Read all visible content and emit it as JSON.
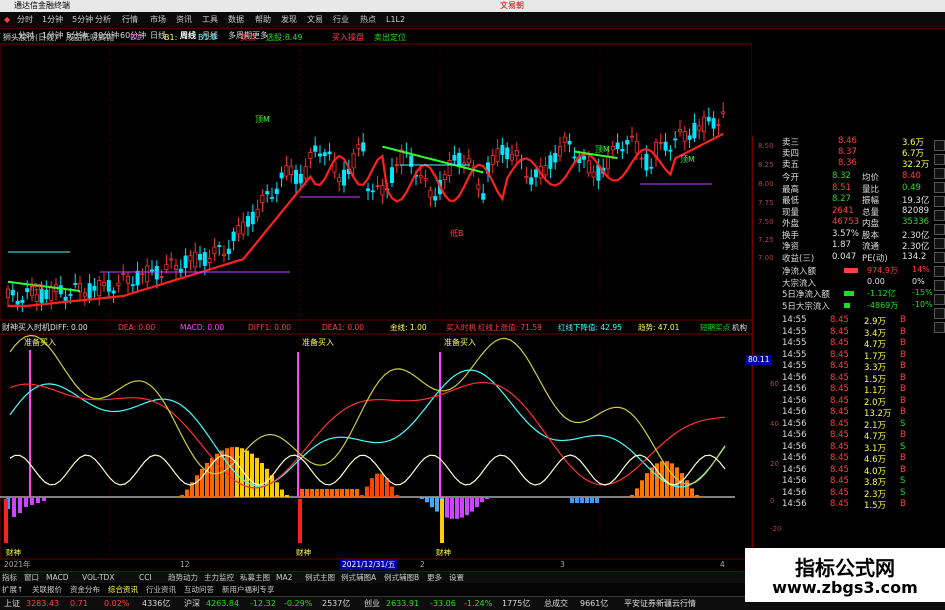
{
  "window": {
    "title": "通达信金融终端",
    "brand": "文易朝"
  },
  "menu": [
    "分时",
    "1分钟",
    "5分钟",
    "分析",
    "行情",
    "市场",
    "资讯",
    "工具",
    "数据",
    "帮助",
    "发现",
    "文易",
    "行业",
    "热点",
    "L1L2"
  ],
  "toolbar": {
    "periods": [
      "分时",
      "1分钟",
      "5分钟",
      "30分钟",
      "60分钟",
      "日线",
      "周线",
      "月线",
      "多周期",
      "更多"
    ],
    "active": "日线"
  },
  "main_chart": {
    "stock": "狮头股份(日线)",
    "indicator": "成品低吸高抛",
    "legend": [
      {
        "label": "B1:",
        "color": "#ff44ff"
      },
      {
        "label": "B1:",
        "color": "#ffff44"
      },
      {
        "label": "B1:8",
        "color": "#44ffff"
      },
      {
        "label": "卖点",
        "color": "#ff4040"
      },
      {
        "label": "选股:8.49",
        "color": "#22dd22"
      },
      {
        "label": "买入操盘",
        "color": "#ff4040"
      },
      {
        "label": "卖出定位",
        "color": "#22dd22"
      }
    ],
    "markers": [
      "顶M",
      "顶M",
      "顶M",
      "低B",
      "低B"
    ],
    "price_axis": [
      "8.50",
      "8.25",
      "8.00",
      "7.75",
      "7.50",
      "7.25",
      "7.00"
    ]
  },
  "sub_chart": {
    "name": "财神买入时机",
    "params": [
      {
        "label": "DIFF: 0.00",
        "color": "#e0e0e0"
      },
      {
        "label": "DEA: 0.00",
        "color": "#ff4040"
      },
      {
        "label": "MACD: 0.00",
        "color": "#ff44ff"
      },
      {
        "label": "DIFF1: 0.00",
        "color": "#ff4040"
      },
      {
        "label": "DEA1: 0.00",
        "color": "#ff4040"
      },
      {
        "label": "金线: 1.00",
        "color": "#ffff44"
      },
      {
        "label": "买入时机",
        "color": "#ff4040"
      },
      {
        "label": "红线上涨值: 71.59",
        "color": "#ff4040"
      },
      {
        "label": "红线下降值: 42.95",
        "color": "#44ffff"
      },
      {
        "label": "趋势: 47.01",
        "color": "#ffff44"
      },
      {
        "label": "短期买点",
        "color": "#22dd22"
      },
      {
        "label": "机构",
        "color": "#e0e0e0"
      }
    ],
    "buy_labels": [
      "准备买入",
      "准备买入",
      "准备买入"
    ],
    "y_axis": [
      "80.11",
      "60",
      "40",
      "20",
      "0",
      "-20"
    ],
    "bottom_labels": [
      "财神",
      "财神",
      "财神"
    ]
  },
  "date_axis": [
    "2021年",
    "12",
    "2021/12/31/五",
    "2",
    "3",
    "4"
  ],
  "order_book": {
    "asks": [
      {
        "label": "卖三",
        "price": "8.46",
        "vol": "3.6万"
      },
      {
        "label": "卖四",
        "price": "8.37",
        "vol": "6.7万"
      },
      {
        "label": "卖五",
        "price": "8.36",
        "vol": "32.2万"
      }
    ]
  },
  "quote_stats": [
    {
      "l1": "今开",
      "v1": "8.32",
      "c1": "grn",
      "l2": "均价",
      "v2": "8.40",
      "c2": "red"
    },
    {
      "l1": "最高",
      "v1": "8.51",
      "c1": "red",
      "l2": "量比",
      "v2": "0.49",
      "c2": "grn"
    },
    {
      "l1": "最低",
      "v1": "8.27",
      "c1": "grn",
      "l2": "振幅",
      "v2": "19.3亿",
      "c2": "wht"
    },
    {
      "l1": "现量",
      "v1": "2641",
      "c1": "red",
      "l2": "总量",
      "v2": "82089",
      "c2": "wht"
    },
    {
      "l1": "外盘",
      "v1": "46753",
      "c1": "red",
      "l2": "内盘",
      "v2": "35336",
      "c2": "grn"
    },
    {
      "l1": "换手",
      "v1": "3.57%",
      "c1": "wht",
      "l2": "股本",
      "v2": "2.30亿",
      "c2": "wht"
    },
    {
      "l1": "净资",
      "v1": "1.87",
      "c1": "wht",
      "l2": "流通",
      "v2": "2.30亿",
      "c2": "wht"
    },
    {
      "l1": "收益(三)",
      "v1": "0.047",
      "c1": "wht",
      "l2": "PE(动)",
      "v2": "134.2",
      "c2": "wht"
    }
  ],
  "fund_flow": [
    {
      "label": "净流入额",
      "value": "974.9万",
      "pct": "14%",
      "vc": "red",
      "bar": 0.7
    },
    {
      "label": "大宗流入",
      "value": "0.00",
      "pct": "0%",
      "vc": "wht",
      "bar": 0
    },
    {
      "label": "5日净流入额",
      "value": "-1.12亿",
      "pct": "-15%",
      "vc": "grn",
      "bar": 0.5
    },
    {
      "label": "5日大宗流入",
      "value": "-4869万",
      "pct": "-10%",
      "vc": "grn",
      "bar": 0.3
    }
  ],
  "ticks": [
    {
      "t": "14:55",
      "p": "8.45",
      "v": "2.9万",
      "s": "B"
    },
    {
      "t": "14:55",
      "p": "8.45",
      "v": "3.4万",
      "s": "B"
    },
    {
      "t": "14:55",
      "p": "8.45",
      "v": "4.7万",
      "s": "B"
    },
    {
      "t": "14:55",
      "p": "8.45",
      "v": "1.7万",
      "s": "B"
    },
    {
      "t": "14:55",
      "p": "8.45",
      "v": "3.3万",
      "s": "B"
    },
    {
      "t": "14:56",
      "p": "8.45",
      "v": "1.5万",
      "s": "B"
    },
    {
      "t": "14:56",
      "p": "8.45",
      "v": "1.1万",
      "s": "B"
    },
    {
      "t": "14:56",
      "p": "8.45",
      "v": "2.0万",
      "s": "B"
    },
    {
      "t": "14:56",
      "p": "8.45",
      "v": "13.2万",
      "s": "B"
    },
    {
      "t": "14:56",
      "p": "8.45",
      "v": "2.1万",
      "s": "S"
    },
    {
      "t": "14:56",
      "p": "8.45",
      "v": "4.7万",
      "s": "B"
    },
    {
      "t": "14:56",
      "p": "8.45",
      "v": "3.1万",
      "s": "S"
    },
    {
      "t": "14:56",
      "p": "8.45",
      "v": "4.6万",
      "s": "B"
    },
    {
      "t": "14:56",
      "p": "8.45",
      "v": "4.0万",
      "s": "B"
    },
    {
      "t": "14:56",
      "p": "8.45",
      "v": "3.8万",
      "s": "S"
    },
    {
      "t": "14:56",
      "p": "8.45",
      "v": "2.3万",
      "s": "S"
    },
    {
      "t": "14:56",
      "p": "8.45",
      "v": "1.5万",
      "s": "B"
    }
  ],
  "bottom_tabs": [
    "指标",
    "窗口",
    "MACD",
    "VOL-TDX",
    "CCI",
    "趋势动力",
    "主力监控",
    "私募主图",
    "MA2",
    "例式主图",
    "例式辅图A",
    "例式辅图B",
    "更多",
    "设置"
  ],
  "bottom_tabs2": [
    "扩展↑",
    "关联报价",
    "资金分布",
    "综合资讯",
    "行业资讯",
    "互动问答",
    "新用户福利专享"
  ],
  "status": [
    {
      "name": "上证",
      "val": "3283.43",
      "chg": "0.71",
      "pct": "0.02%",
      "amt": "4336亿",
      "c": "red"
    },
    {
      "name": "沪深",
      "val": "4263.84",
      "chg": "-12.32",
      "pct": "-0.29%",
      "amt": "2537亿",
      "c": "grn"
    },
    {
      "name": "创业",
      "val": "2633.91",
      "chg": "-33.06",
      "pct": "-1.24%",
      "amt": "1775亿",
      "c": "grn"
    }
  ],
  "status_extra": {
    "label": "总成交",
    "val": "9661亿",
    "broker": "平安证券新疆云行情"
  },
  "watermark": {
    "line1": "指标公式网",
    "line2": "www.zbgs3.com"
  }
}
